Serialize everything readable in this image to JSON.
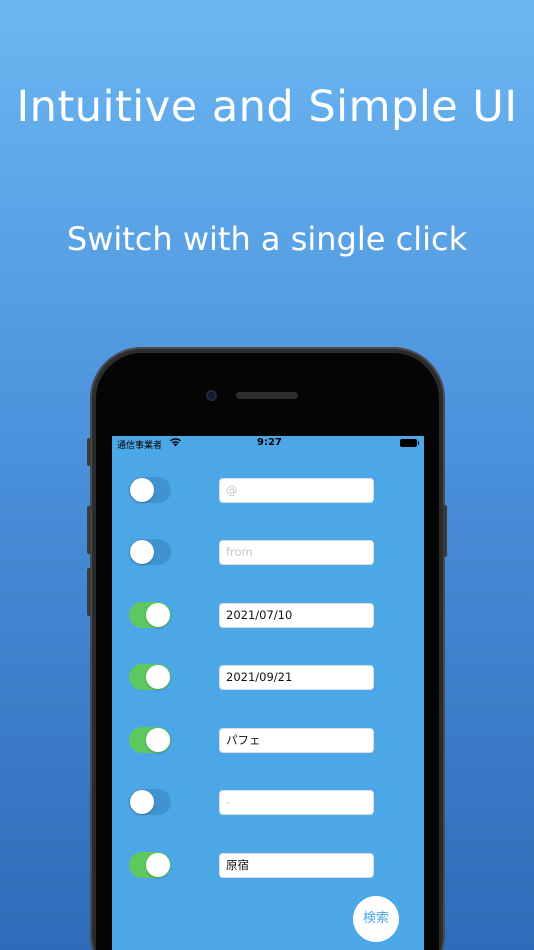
{
  "headline": "Intuitive and Simple UI",
  "subline": "Switch with a single click",
  "status": {
    "carrier": "通信事業者",
    "time": "9:27"
  },
  "rows": [
    {
      "on": false,
      "value": "",
      "placeholder": "@"
    },
    {
      "on": false,
      "value": "",
      "placeholder": "from"
    },
    {
      "on": true,
      "value": "2021/07/10",
      "placeholder": ""
    },
    {
      "on": true,
      "value": "2021/09/21",
      "placeholder": ""
    },
    {
      "on": true,
      "value": "パフェ",
      "placeholder": ""
    },
    {
      "on": false,
      "value": "",
      "placeholder": "-"
    },
    {
      "on": true,
      "value": "原宿",
      "placeholder": ""
    }
  ],
  "search_button": "検索",
  "colors": {
    "screen_bg": "#4ba7e6",
    "toggle_on": "#5dc860",
    "toggle_off": "#3f93cf"
  }
}
